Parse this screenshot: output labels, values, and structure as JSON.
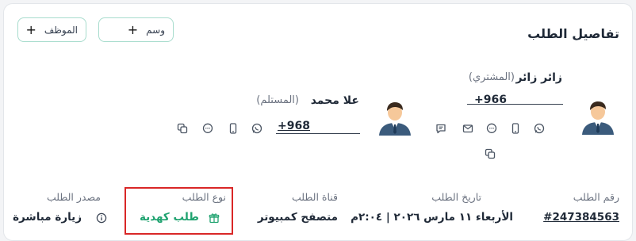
{
  "header": {
    "title": "تفاصيل الطلب",
    "tag_button_label": "وسم",
    "employee_button_label": "الموظف"
  },
  "buyer": {
    "name": "زائر زائر",
    "role": "(المشتري)",
    "phone": "+966"
  },
  "receiver": {
    "name": "علا محمد",
    "role": "(المستلم)",
    "phone": "+968"
  },
  "details": {
    "order_number_label": "رقم الطلب",
    "order_number": "#247384563",
    "order_date_label": "تاريخ الطلب",
    "order_date": "الأربعاء ١١ مارس ٢٠٢٦ | ٢:٠٤م",
    "channel_label": "قناة الطلب",
    "channel": "متصفح كمبيوتر",
    "order_type_label": "نوع الطلب",
    "order_type": "طلب كهدية",
    "source_label": "مصدر الطلب",
    "source": "زيارة مباشرة"
  },
  "colors": {
    "accent_green": "#1ea26f",
    "highlight_red": "#d92727",
    "button_border": "#a7dccd"
  }
}
